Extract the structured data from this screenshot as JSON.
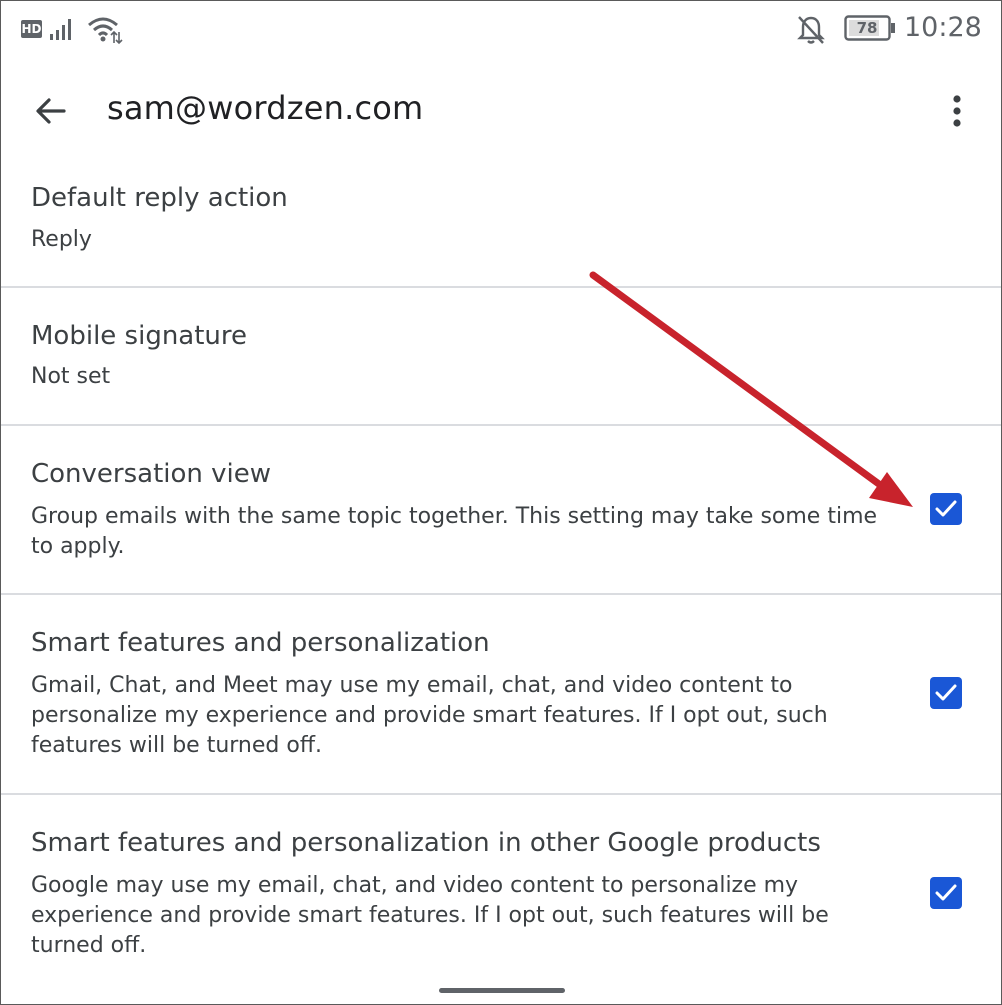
{
  "status_bar": {
    "hd_label": "HD",
    "battery_level": "78",
    "time": "10:28"
  },
  "app_bar": {
    "title": "sam@wordzen.com",
    "back_icon": "arrow-back-icon",
    "more_icon": "more-vert-icon"
  },
  "settings": [
    {
      "title": "Default reply action",
      "value": "Reply"
    },
    {
      "title": "Mobile signature",
      "value": "Not set"
    },
    {
      "title": "Conversation view",
      "description": "Group emails with the same topic together. This setting may take some time to apply.",
      "checked": true
    },
    {
      "title": "Smart features and personalization",
      "description": "Gmail, Chat, and Meet may use my email, chat, and video content to personalize my experience and provide smart features. If I opt out, such features will be turned off.",
      "checked": true
    },
    {
      "title": "Smart features and personalization in other Google products",
      "description": "Google may use my email, chat, and video content to personalize my experience and provide smart features. If I opt out, such features will be turned off.",
      "checked": true
    }
  ],
  "colors": {
    "checkbox": "#1a57d6",
    "annotation_arrow": "#c8232c",
    "divider": "#dadce0"
  }
}
